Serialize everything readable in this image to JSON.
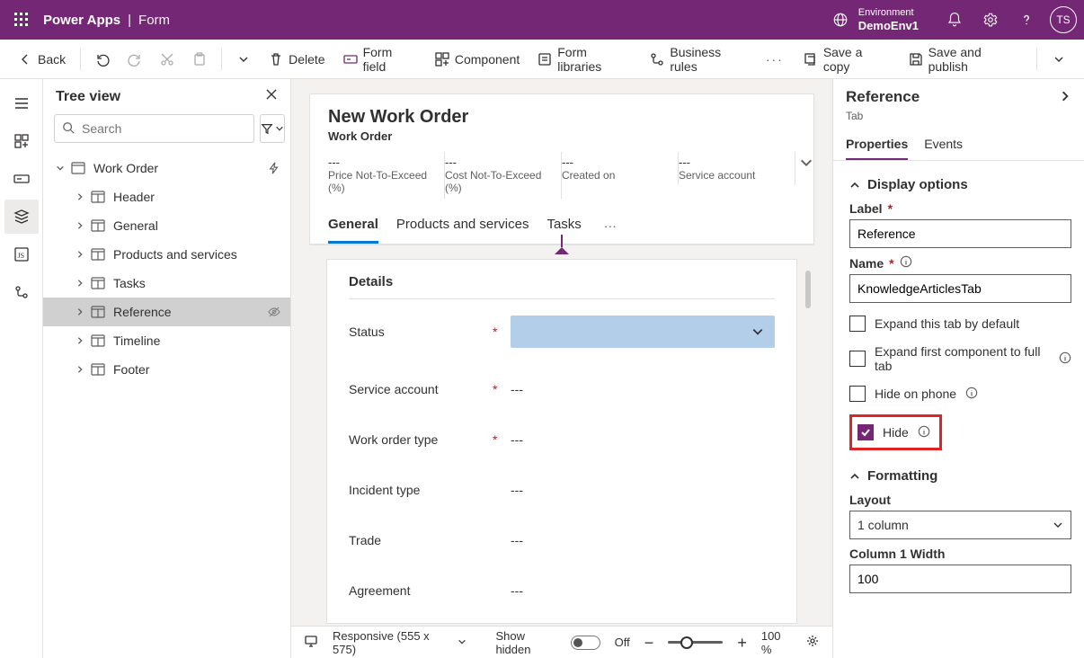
{
  "header": {
    "app": "Power Apps",
    "page": "Form",
    "env_label": "Environment",
    "env_value": "DemoEnv1",
    "avatar": "TS"
  },
  "cmdbar": {
    "back": "Back",
    "delete": "Delete",
    "form_field": "Form field",
    "component": "Component",
    "form_libraries": "Form libraries",
    "business_rules": "Business rules",
    "save_copy": "Save a copy",
    "save_publish": "Save and publish"
  },
  "tree": {
    "title": "Tree view",
    "search_placeholder": "Search",
    "nodes": [
      {
        "label": "Work Order",
        "expanded": true,
        "tail": "bolt"
      },
      {
        "label": "Header",
        "level": 2
      },
      {
        "label": "General",
        "level": 2
      },
      {
        "label": "Products and services",
        "level": 2
      },
      {
        "label": "Tasks",
        "level": 2
      },
      {
        "label": "Reference",
        "level": 2,
        "selected": true,
        "tail": "hidden"
      },
      {
        "label": "Timeline",
        "level": 2
      },
      {
        "label": "Footer",
        "level": 2
      }
    ]
  },
  "form": {
    "title": "New Work Order",
    "entity": "Work Order",
    "stats": [
      {
        "value": "---",
        "label": "Price Not-To-Exceed (%)"
      },
      {
        "value": "---",
        "label": "Cost Not-To-Exceed (%)"
      },
      {
        "value": "---",
        "label": "Created on"
      },
      {
        "value": "---",
        "label": "Service account"
      }
    ],
    "tabs": [
      {
        "label": "General",
        "active": true
      },
      {
        "label": "Products and services"
      },
      {
        "label": "Tasks"
      }
    ],
    "section_title": "Details",
    "fields": [
      {
        "label": "Status",
        "required": true,
        "value": "",
        "kind": "select"
      },
      {
        "label": "Service account",
        "required": true,
        "value": "---"
      },
      {
        "label": "Work order type",
        "required": true,
        "value": "---"
      },
      {
        "label": "Incident type",
        "required": false,
        "value": "---"
      },
      {
        "label": "Trade",
        "required": false,
        "value": "---"
      },
      {
        "label": "Agreement",
        "required": false,
        "value": "---"
      }
    ]
  },
  "canvas_footer": {
    "responsive": "Responsive (555 x 575)",
    "show_hidden": "Show hidden",
    "toggle_state": "Off",
    "zoom": "100 %"
  },
  "props": {
    "title": "Reference",
    "type": "Tab",
    "tabs": {
      "properties": "Properties",
      "events": "Events"
    },
    "display_section": "Display options",
    "label_label": "Label",
    "label_value": "Reference",
    "name_label": "Name",
    "name_value": "KnowledgeArticlesTab",
    "expand_default": "Expand this tab by default",
    "expand_first": "Expand first component to full tab",
    "hide_phone": "Hide on phone",
    "hide": "Hide",
    "formatting_section": "Formatting",
    "layout_label": "Layout",
    "layout_value": "1 column",
    "col_width_label": "Column 1 Width",
    "col_width_value": "100"
  }
}
